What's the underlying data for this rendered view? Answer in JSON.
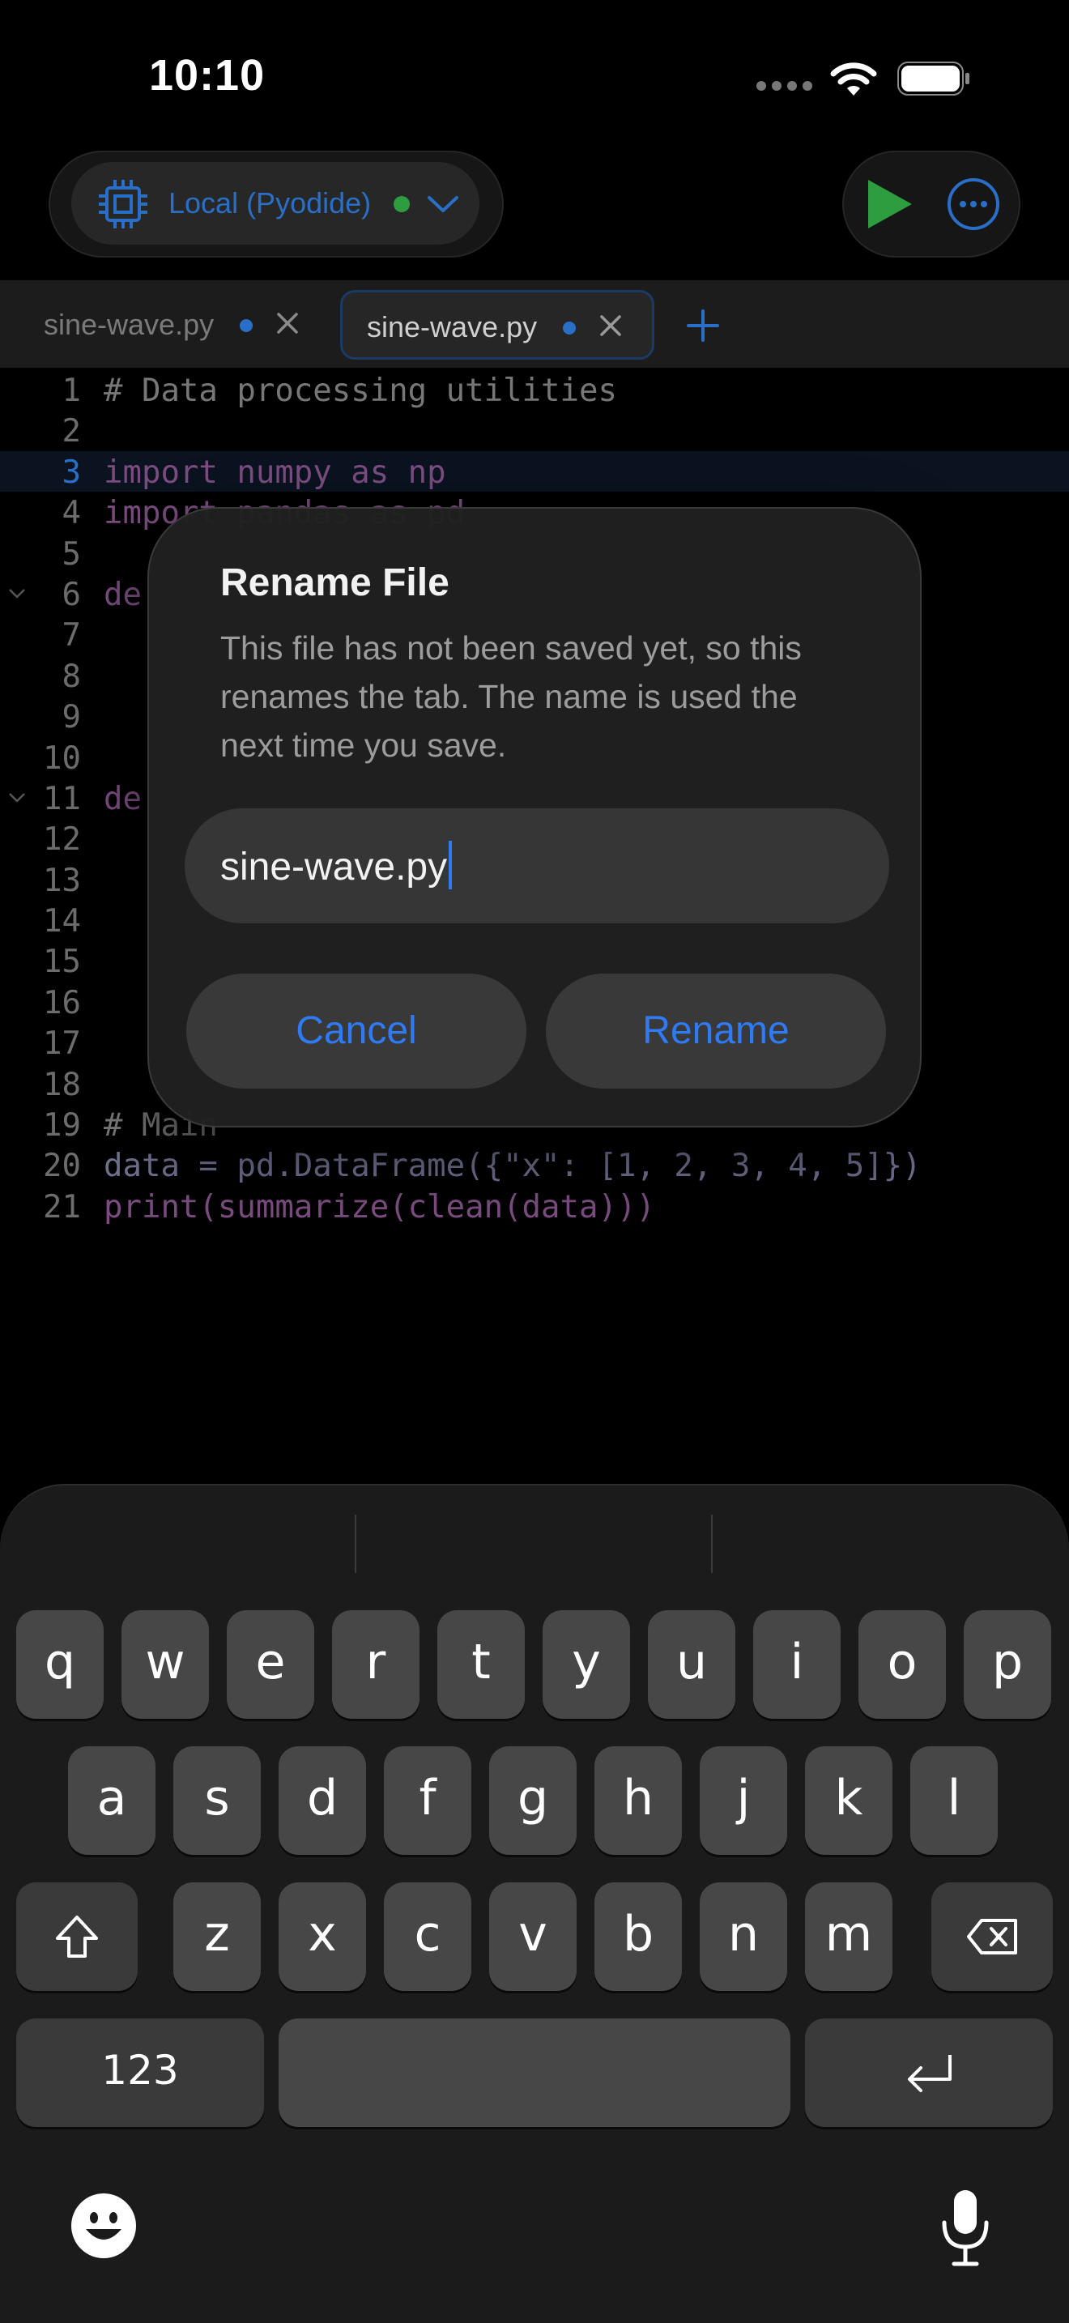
{
  "status_bar": {
    "time": "10:10"
  },
  "toolbar": {
    "runtime_label": "Local (Pyodide)",
    "runtime_status_color": "#2e9d3f",
    "accent_color": "#2a6fc7",
    "run_color": "#2e9d3f"
  },
  "tabs": [
    {
      "label": "sine-wave.py",
      "unsaved": true,
      "active": false
    },
    {
      "label": "sine-wave.py",
      "unsaved": true,
      "active": true
    }
  ],
  "editor": {
    "active_line": 3,
    "lines": [
      {
        "n": "1",
        "text": "# Data processing utilities"
      },
      {
        "n": "2",
        "text": ""
      },
      {
        "n": "3",
        "text": "import numpy as np"
      },
      {
        "n": "4",
        "text": "import pandas as pd"
      },
      {
        "n": "5",
        "text": ""
      },
      {
        "n": "6",
        "text": "de"
      },
      {
        "n": "7",
        "text": ""
      },
      {
        "n": "8",
        "text": ""
      },
      {
        "n": "9",
        "text": ""
      },
      {
        "n": "10",
        "text": ""
      },
      {
        "n": "11",
        "text": "de"
      },
      {
        "n": "12",
        "text": ""
      },
      {
        "n": "13",
        "text": ""
      },
      {
        "n": "14",
        "text": ""
      },
      {
        "n": "15",
        "text": ""
      },
      {
        "n": "16",
        "text": ""
      },
      {
        "n": "17",
        "text": ""
      },
      {
        "n": "18",
        "text": ""
      },
      {
        "n": "19",
        "text": "# Main"
      },
      {
        "n": "20",
        "text": "data = pd.DataFrame({\"x\": [1, 2, 3, 4, 5]})"
      },
      {
        "n": "21",
        "text": "print(summarize(clean(data)))"
      }
    ]
  },
  "dialog": {
    "title": "Rename File",
    "message": "This file has not been saved yet, so this renames the tab. The name is used the next time you save.",
    "input_value": "sine-wave.py",
    "cancel_label": "Cancel",
    "confirm_label": "Rename",
    "button_color": "#2f7bf5"
  },
  "keyboard": {
    "row1": [
      "q",
      "w",
      "e",
      "r",
      "t",
      "y",
      "u",
      "i",
      "o",
      "p"
    ],
    "row2": [
      "a",
      "s",
      "d",
      "f",
      "g",
      "h",
      "j",
      "k",
      "l"
    ],
    "row3": [
      "z",
      "x",
      "c",
      "v",
      "b",
      "n",
      "m"
    ],
    "numbers_label": "123",
    "space_label": "",
    "icons": [
      "shift-icon",
      "delete-icon",
      "return-icon",
      "emoji-icon",
      "microphone-icon"
    ]
  }
}
